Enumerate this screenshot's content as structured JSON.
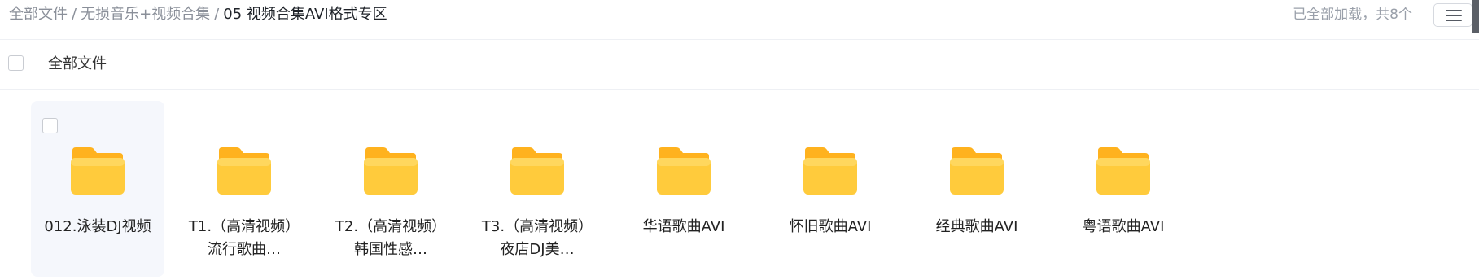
{
  "breadcrumb": {
    "root": "全部文件",
    "sep": "/",
    "parent": "无损音乐+视频合集",
    "current": "05 视频合集AVI格式专区"
  },
  "status": "已全部加载，共8个",
  "list_header": {
    "select_all_label": "全部文件"
  },
  "folders": [
    {
      "name": "012.泳装DJ视频",
      "hover": true
    },
    {
      "name": "T1.（高清视频）流行歌曲…",
      "hover": false
    },
    {
      "name": "T2.（高清视频）韩国性感…",
      "hover": false
    },
    {
      "name": "T3.（高清视频）夜店DJ美…",
      "hover": false
    },
    {
      "name": "华语歌曲AVI",
      "hover": false
    },
    {
      "name": "怀旧歌曲AVI",
      "hover": false
    },
    {
      "name": "经典歌曲AVI",
      "hover": false
    },
    {
      "name": "粤语歌曲AVI",
      "hover": false
    }
  ],
  "icons": {
    "folder": "folder-icon",
    "menu": "menu-icon"
  },
  "colors": {
    "folder_top": "#FFD04A",
    "folder_body": "#FFC83A",
    "hover_bg": "#F5F7FC"
  }
}
